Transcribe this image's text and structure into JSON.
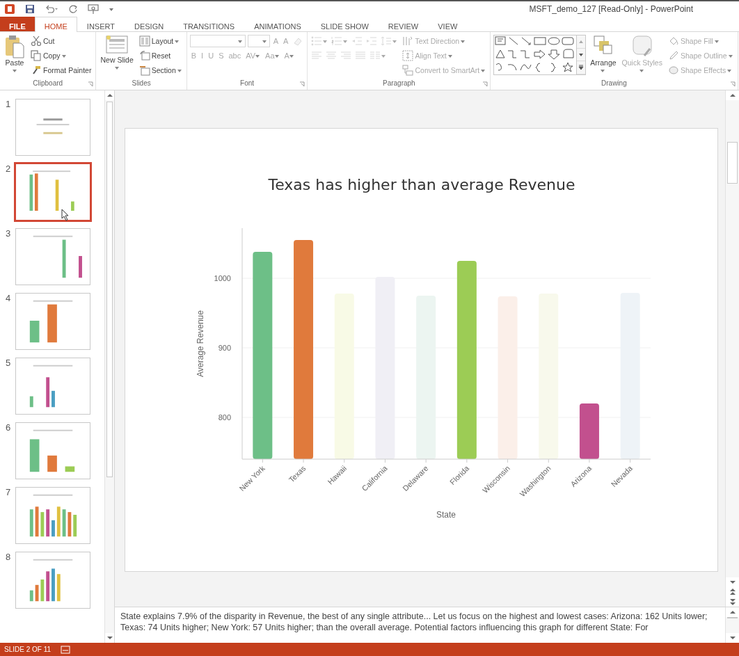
{
  "window": {
    "title": "MSFT_demo_127 [Read-Only] - PowerPoint"
  },
  "tabs": [
    {
      "label": "FILE",
      "kind": "file",
      "selected": false
    },
    {
      "label": "HOME",
      "kind": "tab",
      "selected": true
    },
    {
      "label": "INSERT",
      "kind": "tab",
      "selected": false
    },
    {
      "label": "DESIGN",
      "kind": "tab",
      "selected": false
    },
    {
      "label": "TRANSITIONS",
      "kind": "tab",
      "selected": false
    },
    {
      "label": "ANIMATIONS",
      "kind": "tab",
      "selected": false
    },
    {
      "label": "SLIDE SHOW",
      "kind": "tab",
      "selected": false
    },
    {
      "label": "REVIEW",
      "kind": "tab",
      "selected": false
    },
    {
      "label": "VIEW",
      "kind": "tab",
      "selected": false
    }
  ],
  "ribbon": [
    {
      "label": "Clipboard",
      "launcher": true,
      "columns": [
        [
          [
            {
              "label": "Paste",
              "kind": "large",
              "dropdown": true,
              "disabled": false
            }
          ]
        ],
        [
          [
            {
              "label": "Cut",
              "kind": "small",
              "dropdown": false,
              "disabled": false
            }
          ],
          [
            {
              "label": "Copy",
              "kind": "small",
              "dropdown": true,
              "disabled": false
            }
          ],
          [
            {
              "label": "Format Painter",
              "kind": "small",
              "dropdown": false,
              "disabled": false
            }
          ]
        ]
      ]
    },
    {
      "label": "Slides",
      "launcher": false,
      "columns": [
        [
          [
            {
              "label": "New Slide",
              "kind": "large",
              "dropdown": true,
              "disabled": false
            }
          ]
        ],
        [
          [
            {
              "label": "Layout",
              "kind": "small",
              "dropdown": true,
              "disabled": false
            }
          ],
          [
            {
              "label": "Reset",
              "kind": "small",
              "dropdown": false,
              "disabled": false
            }
          ],
          [
            {
              "label": "Section",
              "kind": "small",
              "dropdown": true,
              "disabled": false
            }
          ]
        ]
      ]
    },
    {
      "label": "Font",
      "launcher": true,
      "columns": [
        [
          [
            {
              "kind": "namefield",
              "dropdown": true,
              "disabled": true
            },
            {
              "kind": "sizefield",
              "dropdown": true,
              "disabled": true
            },
            {
              "label": "A",
              "kind": "glyph",
              "dropdown": false,
              "disabled": true
            },
            {
              "label": "A",
              "kind": "glyph",
              "dropdown": false,
              "disabled": true
            },
            {
              "kind": "icon",
              "disabled": true
            }
          ],
          [
            {
              "label": "B",
              "kind": "glyph",
              "dropdown": false,
              "disabled": true
            },
            {
              "label": "I",
              "kind": "glyph",
              "dropdown": false,
              "disabled": true
            },
            {
              "label": "U",
              "kind": "glyph",
              "dropdown": false,
              "disabled": true
            },
            {
              "label": "S",
              "kind": "glyph",
              "dropdown": false,
              "disabled": true
            },
            {
              "label": "abc",
              "kind": "glyph",
              "dropdown": false,
              "disabled": true
            },
            {
              "label": "AV",
              "kind": "glyph",
              "dropdown": true,
              "disabled": true
            },
            {
              "label": "Aa",
              "kind": "glyph",
              "dropdown": true,
              "disabled": true
            },
            {
              "label": "A",
              "kind": "glyph",
              "dropdown": true,
              "disabled": true
            }
          ]
        ]
      ]
    },
    {
      "label": "Paragraph",
      "launcher": true,
      "columns": [
        [
          [
            {
              "kind": "icon",
              "dropdown": true,
              "disabled": true
            },
            {
              "kind": "icon",
              "dropdown": true,
              "disabled": true
            },
            {
              "kind": "icon",
              "disabled": true
            },
            {
              "kind": "icon",
              "disabled": true
            },
            {
              "kind": "icon",
              "dropdown": true,
              "disabled": true
            }
          ],
          [
            {
              "kind": "icon",
              "disabled": true
            },
            {
              "kind": "icon",
              "disabled": true
            },
            {
              "kind": "icon",
              "disabled": true
            },
            {
              "kind": "icon",
              "disabled": true
            },
            {
              "kind": "icon",
              "dropdown": true,
              "disabled": true
            }
          ]
        ],
        [
          [
            {
              "label": "Text Direction",
              "kind": "small",
              "dropdown": true,
              "disabled": true
            }
          ],
          [
            {
              "label": "Align Text",
              "kind": "small",
              "dropdown": true,
              "disabled": true
            }
          ],
          [
            {
              "label": "Convert to SmartArt",
              "kind": "small",
              "dropdown": true,
              "disabled": true
            }
          ]
        ]
      ]
    },
    {
      "label": "Drawing",
      "launcher": true,
      "columns": [
        [
          [
            {
              "kind": "gallery",
              "disabled": false
            }
          ]
        ],
        [
          [
            {
              "label": "Arrange",
              "kind": "large",
              "dropdown": true,
              "disabled": false
            }
          ]
        ],
        [
          [
            {
              "label": "Quick Styles",
              "kind": "large",
              "dropdown": true,
              "disabled": true
            }
          ]
        ],
        [
          [
            {
              "label": "Shape Fill",
              "kind": "small",
              "dropdown": true,
              "disabled": true
            }
          ],
          [
            {
              "label": "Shape Outline",
              "kind": "small",
              "dropdown": true,
              "disabled": true
            }
          ],
          [
            {
              "label": "Shape Effects",
              "kind": "small",
              "dropdown": true,
              "disabled": true
            }
          ]
        ]
      ]
    }
  ],
  "slides": [
    {
      "number": "1",
      "selected": false
    },
    {
      "number": "2",
      "selected": true
    },
    {
      "number": "3",
      "selected": false
    },
    {
      "number": "4",
      "selected": false
    },
    {
      "number": "5",
      "selected": false
    },
    {
      "number": "6",
      "selected": false
    },
    {
      "number": "7",
      "selected": false
    },
    {
      "number": "8",
      "selected": false
    }
  ],
  "slide": {
    "chart_data": {
      "type": "bar",
      "title": "Texas has higher than average Revenue",
      "xlabel": "State",
      "ylabel": "Average Revenue",
      "categories": [
        "New York",
        "Texas",
        "Hawaii",
        "California",
        "Delaware",
        "Florida",
        "Wisconsin",
        "Washington",
        "Arizona",
        "Nevada"
      ],
      "series": [
        {
          "colors": [
            "#6dbf87",
            "#e07a3c",
            "#f8fae6",
            "#f0eff5",
            "#ecf5f1",
            "#9ccc55",
            "#fbefe9",
            "#f8f9ec",
            "#c2508e",
            "#eef3f7"
          ],
          "values": [
            1038,
            1055,
            978,
            1002,
            975,
            1025,
            974,
            978,
            820,
            979
          ]
        }
      ],
      "ylim": [
        740,
        1072
      ],
      "yticks": [
        800,
        900,
        1000
      ],
      "grid": true
    }
  },
  "notes": "State explains 7.9% of the disparity in Revenue, the best of any single attribute... Let us focus on the highest and lowest cases: Arizona: 162 Units lower; Texas: 74 Units higher; New York: 57 Units higher; than the overall average. Potential factors influencing this graph for different State:  For",
  "status_bar": {
    "slide_indicator": "SLIDE 2 OF 11"
  }
}
